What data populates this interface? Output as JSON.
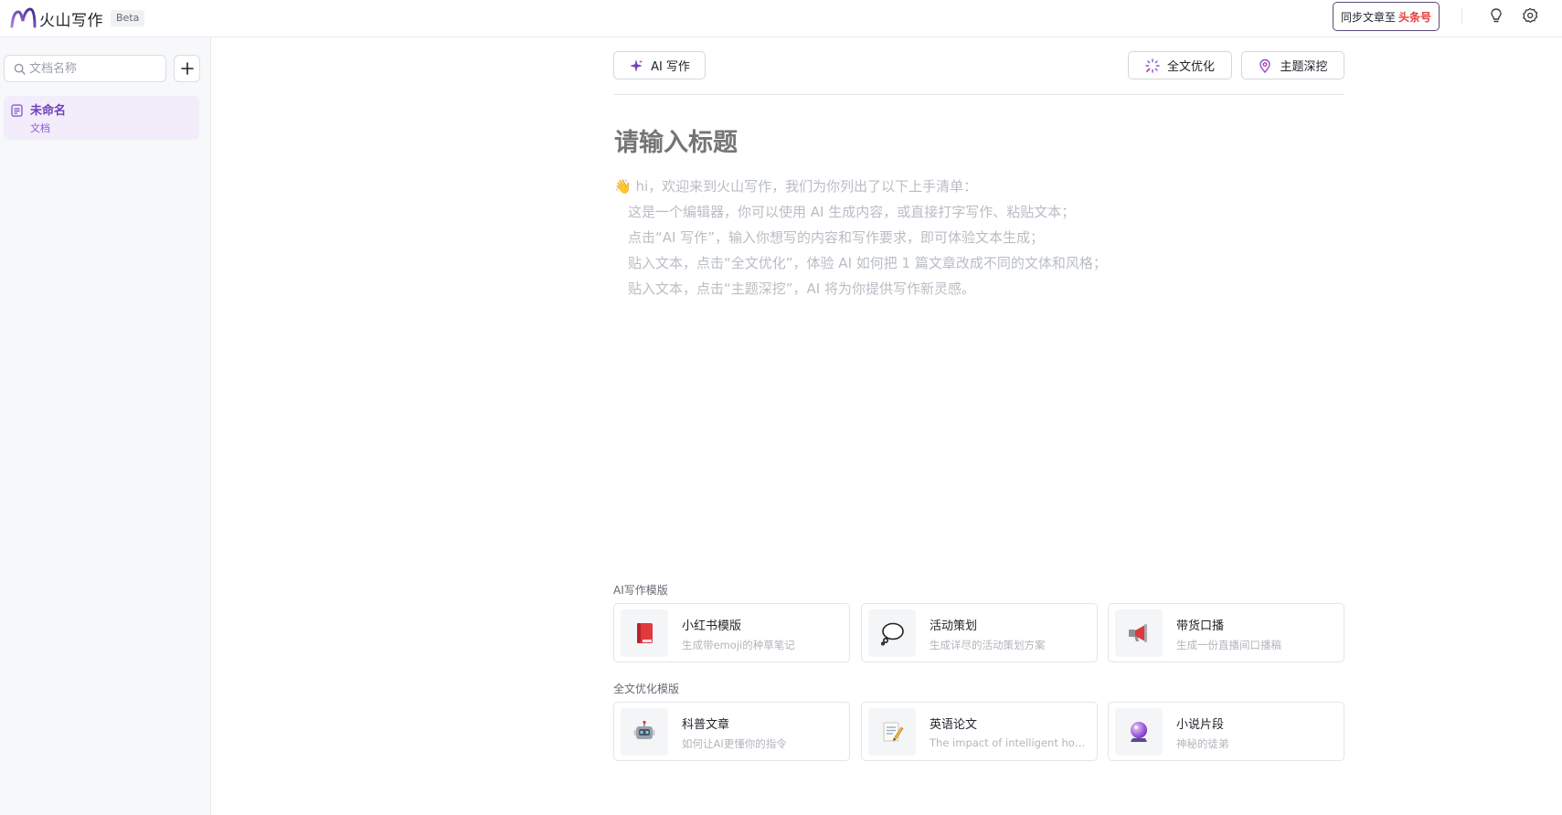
{
  "app": {
    "name": "火山写作",
    "badge": "Beta"
  },
  "header": {
    "sync_prefix": "同步文章至",
    "sync_platform": "头条号",
    "icons": [
      "lightbulb-icon",
      "settings-icon"
    ]
  },
  "sidebar": {
    "search_placeholder": "文档名称",
    "add_icon": "plus-icon",
    "documents": [
      {
        "title": "未命名",
        "type": "文档"
      }
    ]
  },
  "toolbar": {
    "ai_write": "AI 写作",
    "optimize": "全文优化",
    "deep_dive": "主题深挖"
  },
  "editor": {
    "title_placeholder": "请输入标题",
    "guide": [
      "👋 hi，欢迎来到火山写作，我们为你列出了以下上手清单：",
      "这是一个编辑器，你可以使用 AI 生成内容，或直接打字写作、粘贴文本；",
      "点击“AI 写作”，输入你想写的内容和写作要求，即可体验文本生成；",
      "贴入文本，点击“全文优化”，体验 AI 如何把 1 篇文章改成不同的文体和风格；",
      "贴入文本，点击“主题深挖”，AI 将为你提供写作新灵感。"
    ]
  },
  "templates": {
    "ai_label": "AI写作模版",
    "ai": [
      {
        "title": "小红书模版",
        "desc": "生成带emoji的种草笔记",
        "icon": "red-book-icon"
      },
      {
        "title": "活动策划",
        "desc": "生成详尽的活动策划方案",
        "icon": "speech-bubble-icon"
      },
      {
        "title": "带货口播",
        "desc": "生成一份直播间口播稿",
        "icon": "megaphone-icon"
      }
    ],
    "optimize_label": "全文优化模版",
    "optimize": [
      {
        "title": "科普文章",
        "desc": "如何让AI更懂你的指令",
        "icon": "robot-icon"
      },
      {
        "title": "英语论文",
        "desc": "The impact of intelligent household robots on family life",
        "icon": "memo-icon"
      },
      {
        "title": "小说片段",
        "desc": "神秘的徒弟",
        "icon": "crystal-ball-icon"
      }
    ]
  },
  "colors": {
    "accent": "#7b4cc2",
    "brand_red": "#e53c3c"
  }
}
